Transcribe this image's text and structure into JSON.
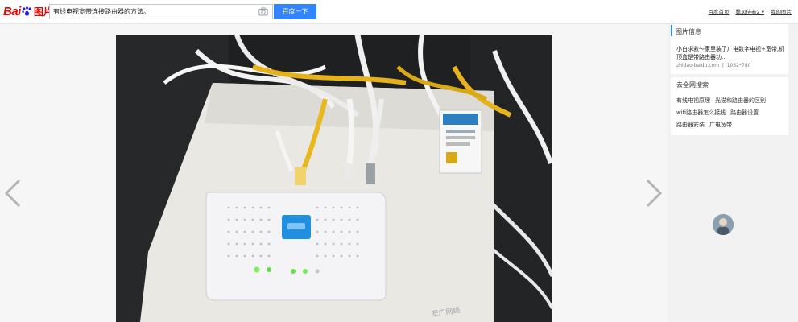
{
  "logo": {
    "brand_text": "Bai",
    "brand_du": "du",
    "brand_suffix": "图片"
  },
  "search": {
    "query": "有线电视宽带连接路由器的方法。",
    "button_label": "百度一下"
  },
  "top_links": [
    "百度首页",
    "桑风侍者2 ▾",
    "我的图片"
  ],
  "sidebar": {
    "info": {
      "title": "图片信息",
      "description": "小白求救～家里装了广电数字电视+宽带,机顶盒是带路由器功...",
      "source": "zhidao.baidu.com",
      "size": "1052*780"
    },
    "related": {
      "title": "去全网搜索",
      "tags": [
        "有线电视原理",
        "光猫和路由器的区别",
        "wifi路由器怎么接线",
        "路由器设置",
        "路由器安装",
        "广电宽带"
      ]
    }
  },
  "photo_label": "安广网络"
}
